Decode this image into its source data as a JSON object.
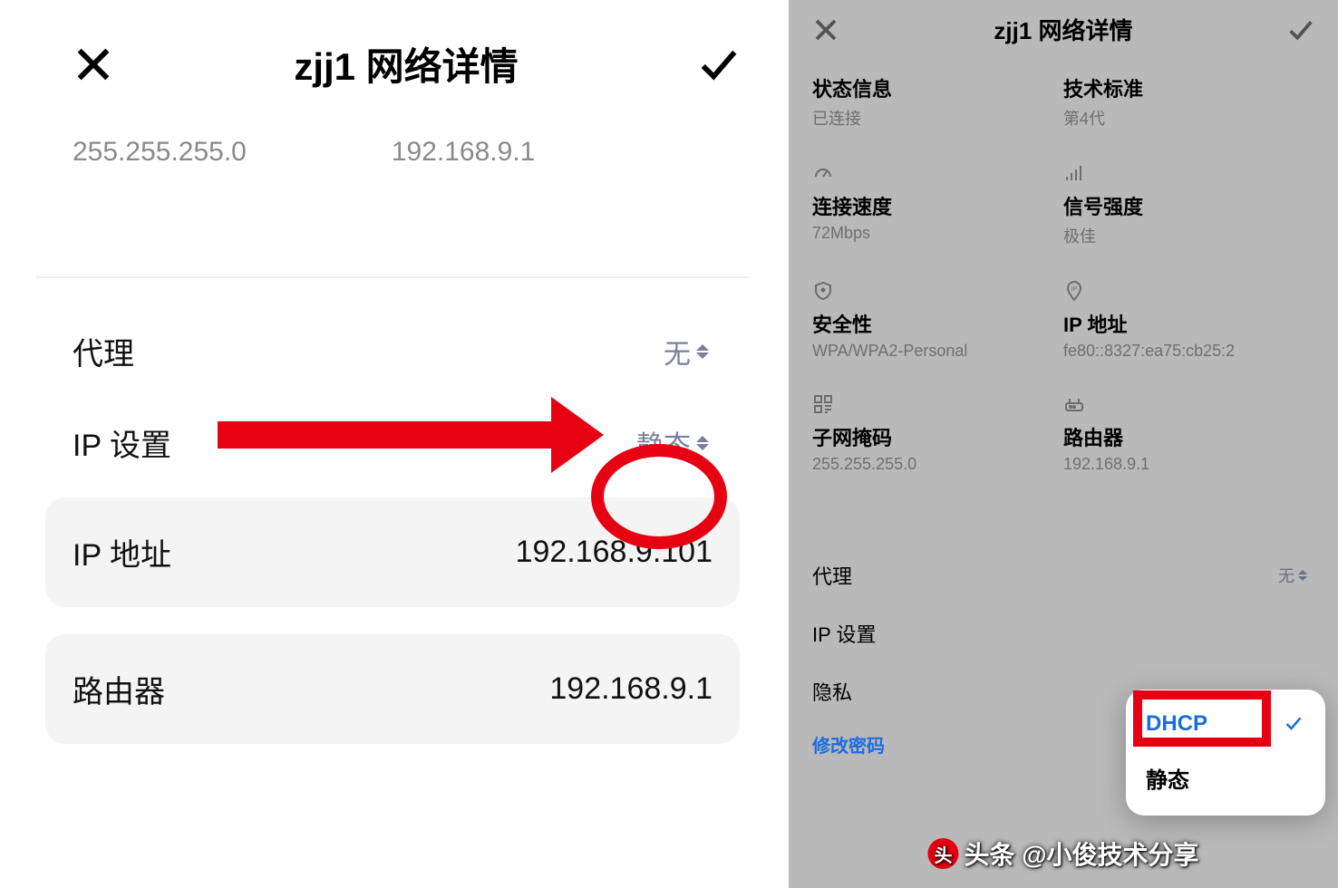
{
  "left": {
    "title": "zjj1 网络详情",
    "subnet_mask": "255.255.255.0",
    "router": "192.168.9.1",
    "proxy": {
      "label": "代理",
      "value": "无"
    },
    "ip_settings": {
      "label": "IP 设置",
      "value": "静态"
    },
    "ip_address": {
      "label": "IP 地址",
      "value": "192.168.9.101"
    },
    "router_row": {
      "label": "路由器",
      "value": "192.168.9.1"
    }
  },
  "right": {
    "title": "zjj1 网络详情",
    "cells": {
      "status": {
        "label": "状态信息",
        "value": "已连接"
      },
      "standard": {
        "label": "技术标准",
        "value": "第4代"
      },
      "speed": {
        "label": "连接速度",
        "value": "72Mbps"
      },
      "signal": {
        "label": "信号强度",
        "value": "极佳"
      },
      "security": {
        "label": "安全性",
        "value": "WPA/WPA2-Personal"
      },
      "ip": {
        "label": "IP 地址",
        "value": "fe80::8327:ea75:cb25:2"
      },
      "mask": {
        "label": "子网掩码",
        "value": "255.255.255.0"
      },
      "router": {
        "label": "路由器",
        "value": "192.168.9.1"
      }
    },
    "proxy": {
      "label": "代理",
      "value": "无"
    },
    "ip_set": {
      "label": "IP 设置"
    },
    "privacy": {
      "label": "隐私"
    },
    "change_pw": "修改密码",
    "popup": {
      "option1": "DHCP",
      "option2": "静态"
    }
  },
  "watermark": "头条 @小俊技术分享"
}
